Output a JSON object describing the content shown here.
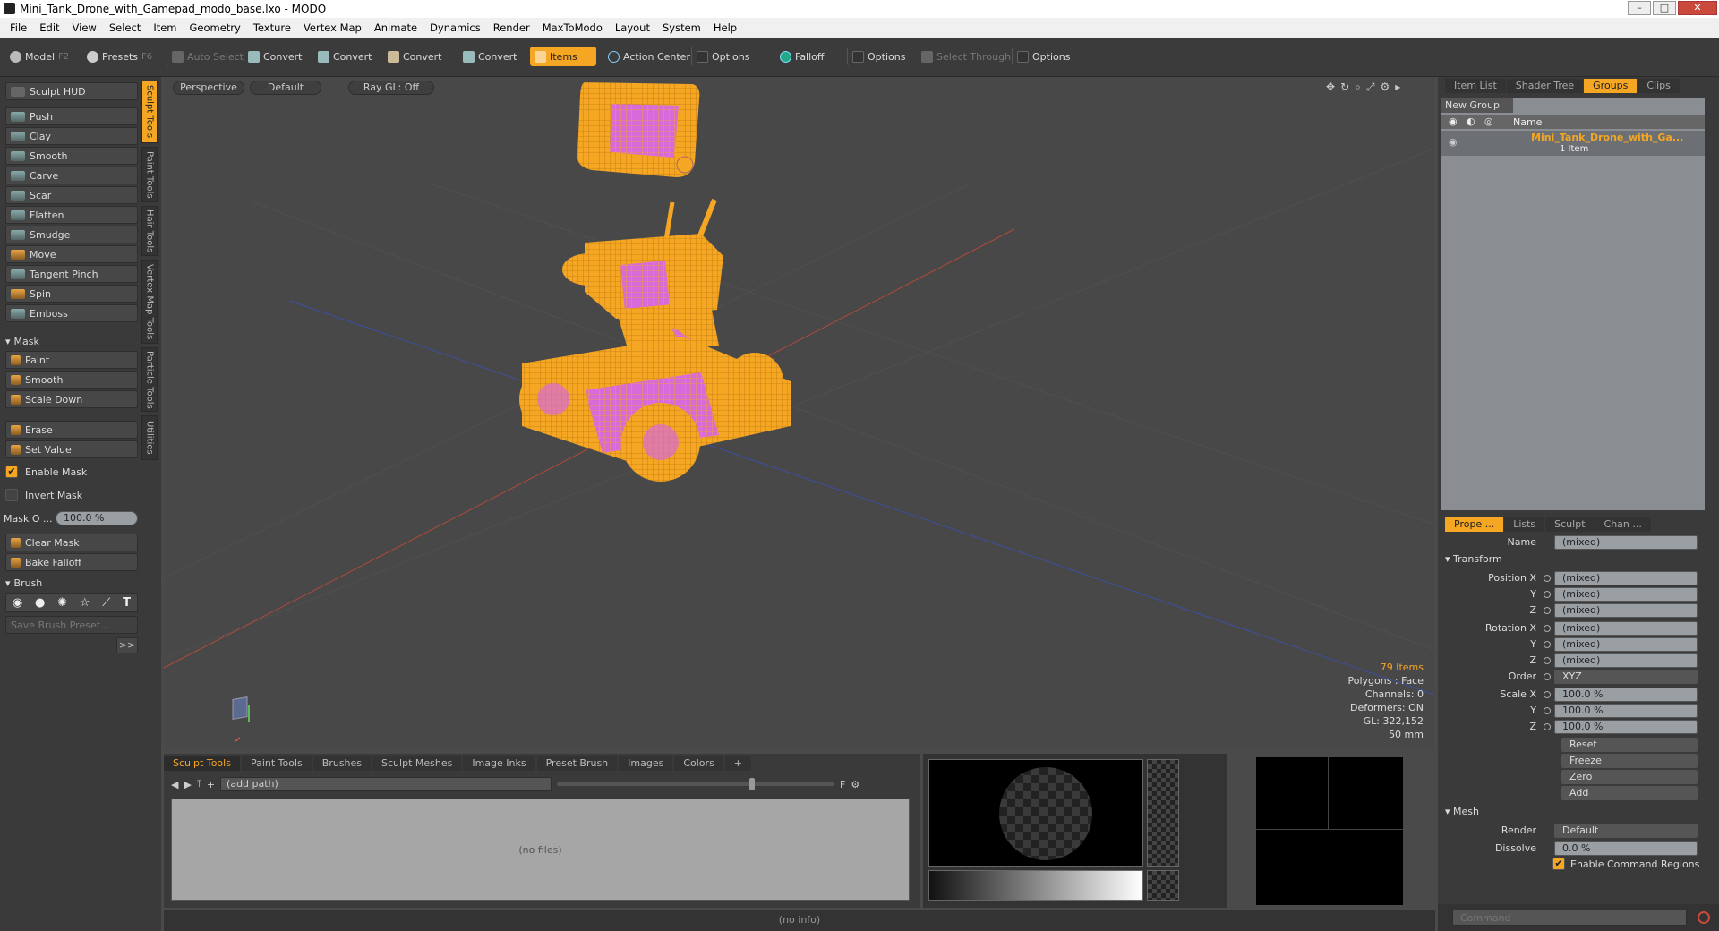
{
  "window": {
    "title": "Mini_Tank_Drone_with_Gamepad_modo_base.lxo - MODO"
  },
  "menu": [
    "File",
    "Edit",
    "View",
    "Select",
    "Item",
    "Geometry",
    "Texture",
    "Vertex Map",
    "Animate",
    "Dynamics",
    "Render",
    "MaxToModo",
    "Layout",
    "System",
    "Help"
  ],
  "toolbar": {
    "model": "Model",
    "model_key": "F2",
    "presets": "Presets",
    "presets_key": "F6",
    "auto_select": "Auto Select",
    "convert": "Convert",
    "items": "Items",
    "action_center": "Action Center",
    "options": "Options",
    "falloff": "Falloff",
    "select_through": "Select Through"
  },
  "sculpt": {
    "hud": "Sculpt HUD",
    "tools": [
      "Push",
      "Clay",
      "Smooth",
      "Carve",
      "Scar",
      "Flatten",
      "Smudge",
      "Move",
      "Tangent Pinch",
      "Spin",
      "Emboss"
    ],
    "mask_header": "Mask",
    "mask_tools": [
      "Paint",
      "Smooth",
      "Scale Down"
    ],
    "erase": "Erase",
    "set_value": "Set Value",
    "enable_mask": "Enable Mask",
    "invert_mask": "Invert Mask",
    "mask_opacity_label": "Mask O ...",
    "mask_opacity_value": "100.0 %",
    "clear_mask": "Clear Mask",
    "bake_falloff": "Bake Falloff",
    "brush_header": "Brush",
    "save_brush": "Save Brush Preset...",
    "more": ">>"
  },
  "vtabs": [
    "Sculpt Tools",
    "Paint Tools",
    "Hair Tools",
    "Vertex Map Tools",
    "Particle Tools",
    "Utilities"
  ],
  "viewport": {
    "view": "Perspective",
    "shading": "Default",
    "raygl": "Ray GL: Off",
    "items_count": "79 Items",
    "polygons": "Polygons : Face",
    "channels": "Channels: 0",
    "deformers": "Deformers: ON",
    "gl": "GL: 322,152",
    "scale": "50 mm"
  },
  "bottom": {
    "tabs": [
      "Sculpt Tools",
      "Paint Tools",
      "Brushes",
      "Sculpt Meshes",
      "Image Inks",
      "Preset Brush",
      "Images",
      "Colors"
    ],
    "path": "(add path)",
    "empty": "(no files)"
  },
  "status": "(no info)",
  "right": {
    "top_tabs": [
      "Item List",
      "Shader Tree",
      "Groups",
      "Clips"
    ],
    "new_group": "New Group",
    "col_name": "Name",
    "group_name": "Mini_Tank_Drone_with_Ga...",
    "group_count": "1 Item",
    "prop_tabs": [
      "Prope ...",
      "Lists",
      "Sculpt",
      "Chan ..."
    ],
    "name_label": "Name",
    "name_value": "(mixed)",
    "transform": "Transform",
    "position_x": "Position X",
    "rotation_x": "Rotation X",
    "scale_x": "Scale X",
    "y": "Y",
    "z": "Z",
    "mixed": "(mixed)",
    "order_label": "Order",
    "order_value": "XYZ",
    "scale_value": "100.0 %",
    "reset": "Reset",
    "freeze": "Freeze",
    "zero": "Zero",
    "add": "Add",
    "mesh": "Mesh",
    "render_label": "Render",
    "render_value": "Default",
    "dissolve_label": "Dissolve",
    "dissolve_value": "0.0 %",
    "enable_cmd": "Enable Command Regions",
    "command_placeholder": "Command"
  },
  "colors": {
    "accent": "#f5a623",
    "mesh": "#f5a623",
    "mesh_inner": "#d86bd9"
  }
}
